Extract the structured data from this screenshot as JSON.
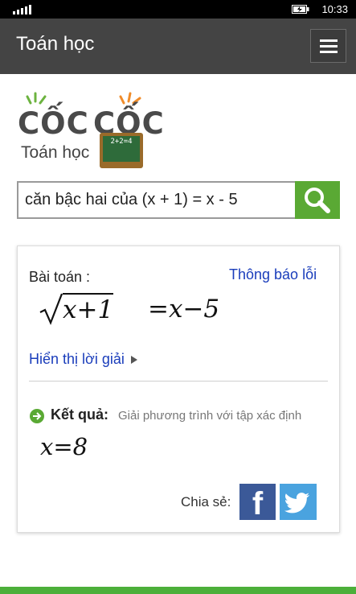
{
  "status": {
    "time": "10:33",
    "signal": "signal-icon",
    "battery": "battery-charging-icon"
  },
  "appbar": {
    "title": "Toán học",
    "menu_icon": "hamburger-menu-icon"
  },
  "logo": {
    "word1": "CỐC",
    "word2": "CỐC",
    "subtitle": "Toán học",
    "board_text": "2+2=4"
  },
  "search": {
    "value": "căn bậc hai của (x + 1) = x - 5",
    "button_icon": "search-icon"
  },
  "problem": {
    "label": "Bài toán :",
    "report_link": "Thông báo lỗi",
    "radicand": "x+1",
    "rhs": "=x−5",
    "show_solution": "Hiển thị lời giải"
  },
  "result": {
    "title": "Kết quả:",
    "description": "Giải phương trình với tập xác định",
    "equation": "x=8"
  },
  "share": {
    "label": "Chia sẻ:",
    "facebook_glyph": "f"
  },
  "colors": {
    "appbar": "#444444",
    "accent_green": "#5aa934",
    "link_blue": "#1a3dbb",
    "facebook": "#3b5998",
    "twitter": "#4aa3df"
  }
}
